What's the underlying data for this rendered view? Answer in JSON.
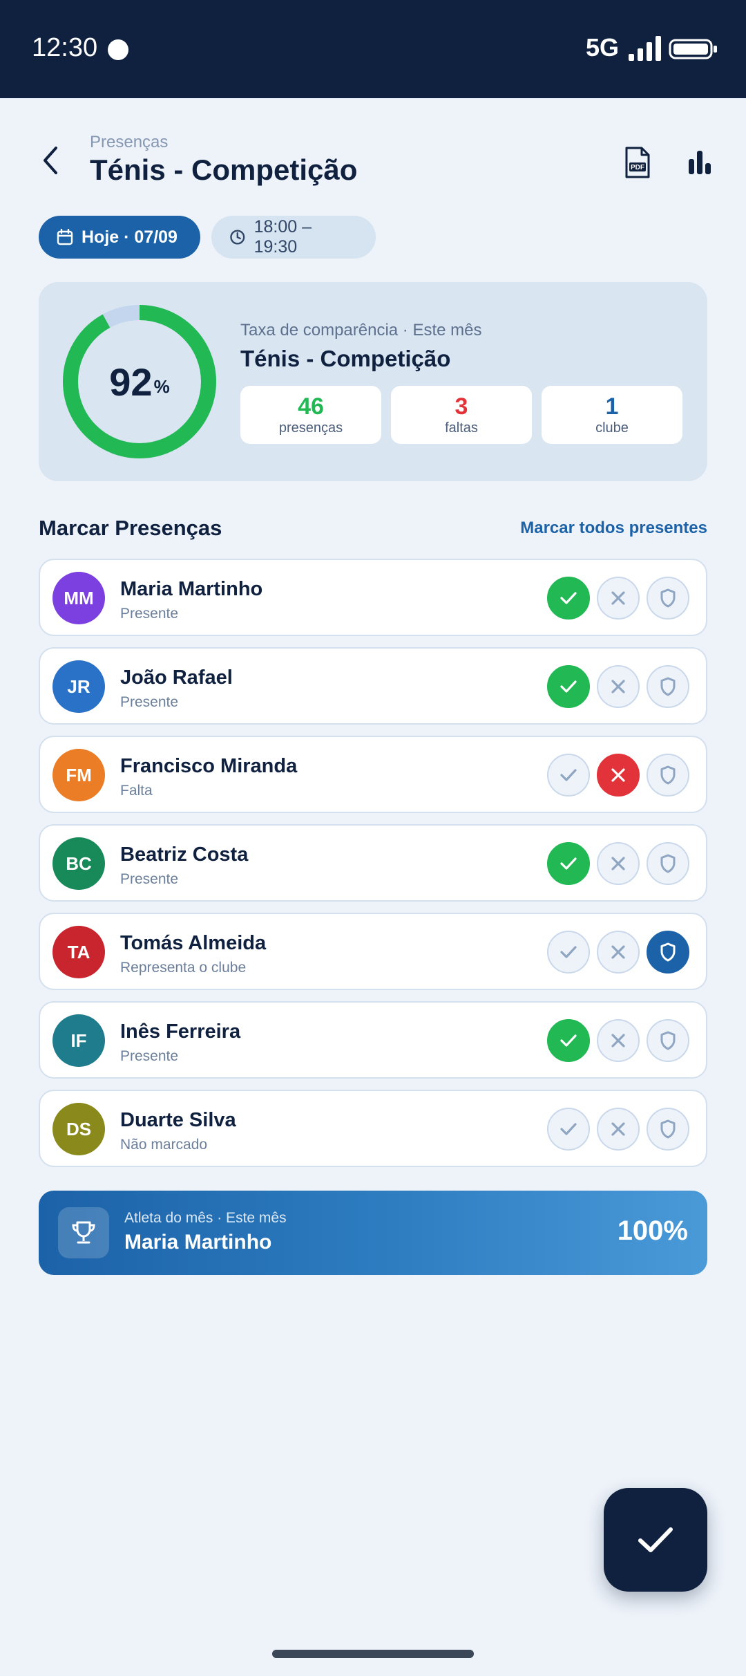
{
  "status_bar": {
    "time": "12:30",
    "network": "5G"
  },
  "header": {
    "breadcrumb": "Presenças",
    "title": "Ténis - Competição"
  },
  "filters": {
    "date": "Hoje · 07/09",
    "time_range": "18:00 – 19:30"
  },
  "stats": {
    "rate_value": "92",
    "rate_unit": "%",
    "rate_fraction": 0.92,
    "rate_label": "Taxa de comparência · Este mês",
    "group_name": "Ténis - Competição",
    "items": [
      {
        "value": "46",
        "label": "presenças",
        "color": "#22b955"
      },
      {
        "value": "3",
        "label": "faltas",
        "color": "#e2323a"
      },
      {
        "value": "1",
        "label": "clube",
        "color": "#1c62a8"
      }
    ]
  },
  "section": {
    "title": "Marcar Presenças",
    "mark_all": "Marcar todos presentes"
  },
  "athletes": [
    {
      "initials": "MM",
      "name": "Maria Martinho",
      "status": "Presente",
      "state": "present",
      "color": "#7c3fe0"
    },
    {
      "initials": "JR",
      "name": "João Rafael",
      "status": "Presente",
      "state": "present",
      "color": "#2a72c8"
    },
    {
      "initials": "FM",
      "name": "Francisco Miranda",
      "status": "Falta",
      "state": "absent",
      "color": "#ea7d26"
    },
    {
      "initials": "BC",
      "name": "Beatriz Costa",
      "status": "Presente",
      "state": "present",
      "color": "#188a5a"
    },
    {
      "initials": "TA",
      "name": "Tomás Almeida",
      "status": "Representa o clube",
      "state": "club",
      "color": "#c9252f"
    },
    {
      "initials": "IF",
      "name": "Inês Ferreira",
      "status": "Presente",
      "state": "present",
      "color": "#1e7c8c"
    },
    {
      "initials": "DS",
      "name": "Duarte Silva",
      "status": "Não marcado",
      "state": "none",
      "color": "#8a8a1c"
    }
  ],
  "athlete_of_month": {
    "label": "Atleta do mês · Este mês",
    "name": "Maria Martinho",
    "value": "100%"
  },
  "colors": {
    "primary": "#1c62a8",
    "navy": "#0f213f",
    "present": "#22b955",
    "absent": "#e2323a"
  }
}
